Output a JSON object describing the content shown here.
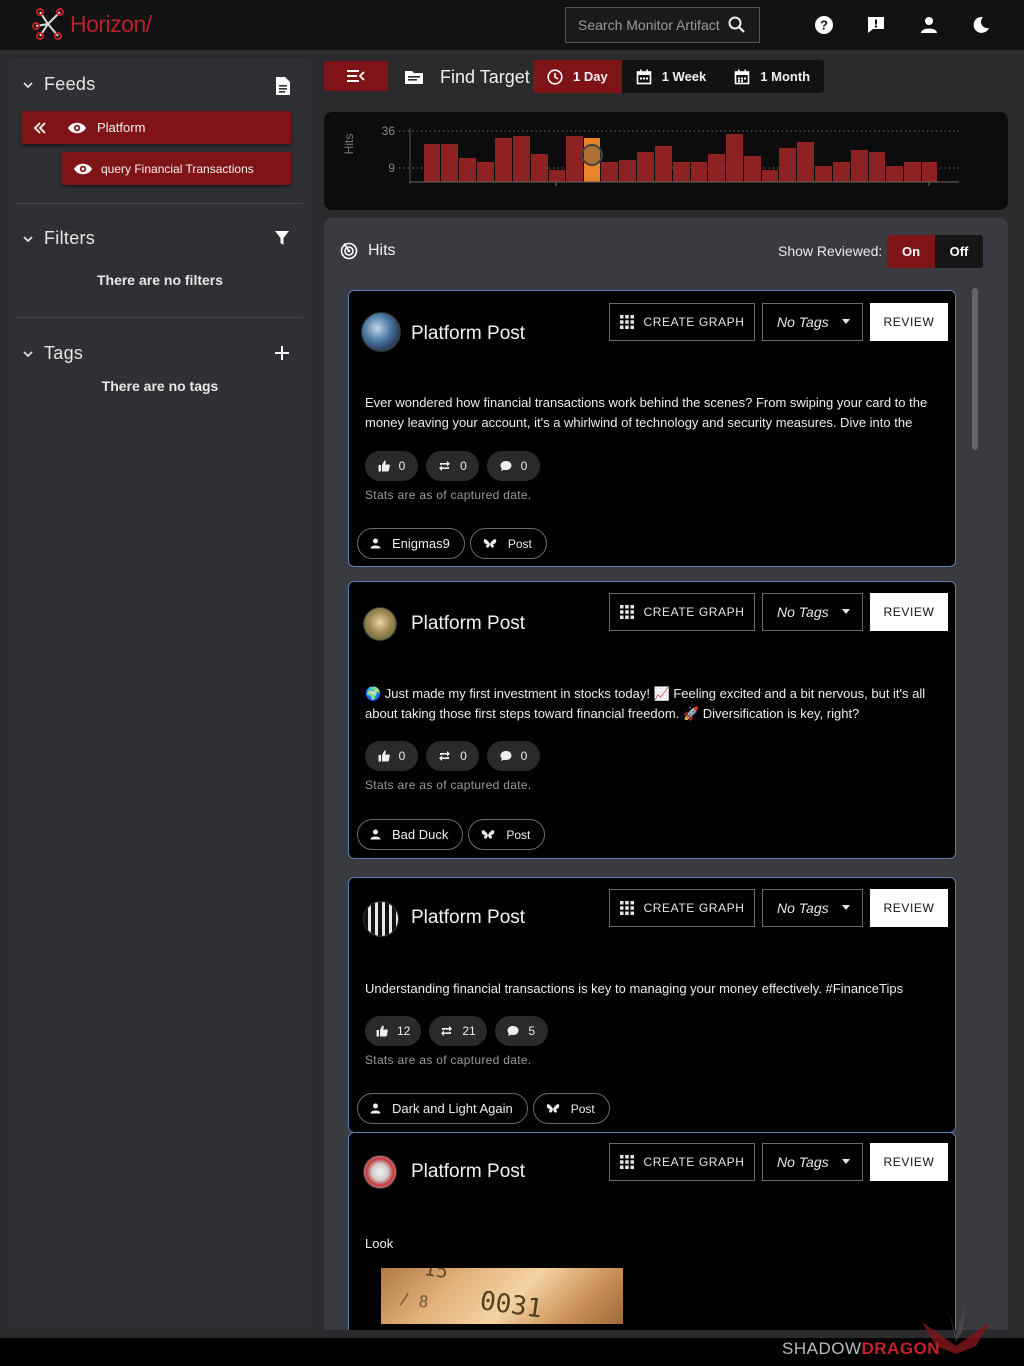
{
  "app": {
    "name": "Horizon/",
    "accent": "#7f1418",
    "brand_red": "#b5222a"
  },
  "search": {
    "placeholder": "Search Monitor Artifacts"
  },
  "topbar_icons": [
    "help-icon",
    "alert-icon",
    "user-icon",
    "dark-mode-icon"
  ],
  "sidebar": {
    "feeds": {
      "title": "Feeds",
      "items": [
        {
          "label": "Platform"
        },
        {
          "label": "query Financial Transactions"
        }
      ]
    },
    "filters": {
      "title": "Filters",
      "empty": "There are no filters"
    },
    "tags": {
      "title": "Tags",
      "empty": "There are no tags"
    }
  },
  "main": {
    "find_target_label": "Find Target",
    "ranges": [
      {
        "label": "1 Day",
        "active": true
      },
      {
        "label": "1 Week",
        "active": false
      },
      {
        "label": "1 Month",
        "active": false
      }
    ]
  },
  "histogram": {
    "ylabel": "Hits",
    "ticks": [
      36,
      9
    ]
  },
  "hits": {
    "title": "Hits",
    "show_reviewed_label": "Show Reviewed:",
    "toggle_on": "On",
    "toggle_off": "Off",
    "create_graph_label": "CREATE GRAPH",
    "tags_label": "No Tags",
    "review_label": "REVIEW",
    "stats_note": "Stats are as of captured date.",
    "posts": [
      {
        "title": "Platform Post",
        "text": "Ever wondered how financial transactions work behind the scenes? From swiping your card to the money leaving your account, it's a whirlwind of technology and security measures. Dive into the",
        "likes": "0",
        "reposts": "0",
        "comments": "0",
        "author": "Enigmas9",
        "type": "Post"
      },
      {
        "title": "Platform Post",
        "text": "🌍 Just made my first investment in stocks today! 📈 Feeling excited and a bit nervous, but it's all about taking those first steps toward financial freedom. 🚀 Diversification is key, right?",
        "likes": "0",
        "reposts": "0",
        "comments": "0",
        "author": "Bad Duck",
        "type": "Post"
      },
      {
        "title": "Platform Post",
        "text": "Understanding financial transactions is key to managing your money effectively. #FinanceTips",
        "likes": "12",
        "reposts": "21",
        "comments": "5",
        "author": "Dark and Light Again",
        "type": "Post"
      },
      {
        "title": "Platform Post",
        "text": "Look"
      }
    ]
  },
  "footer": {
    "brand_a": "SHADOW",
    "brand_b": "DRAGON"
  }
}
